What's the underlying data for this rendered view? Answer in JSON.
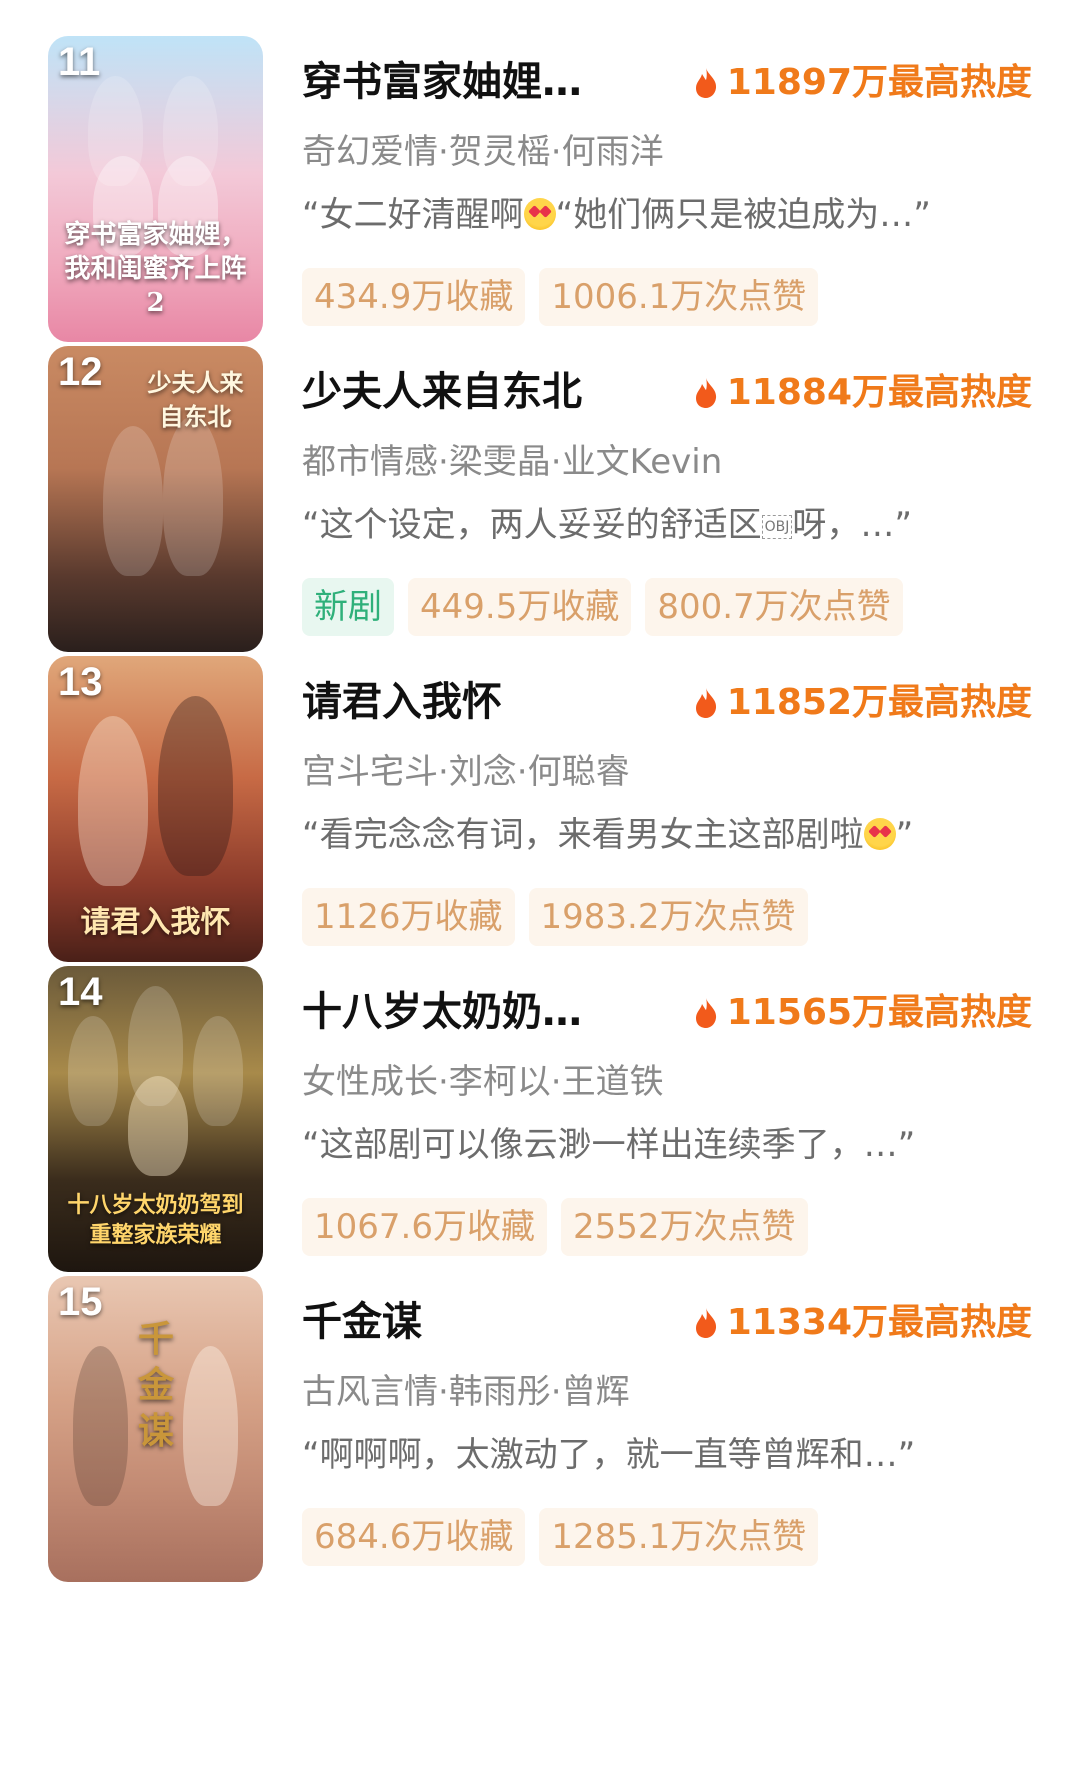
{
  "items": [
    {
      "rank": "11",
      "title": "穿书富家妯娌…",
      "heat": "11897万最高热度",
      "meta": "奇幻爱情·贺灵榣·何雨洋",
      "quote_a": "“女二好清醒啊",
      "quote_b": "“她们俩只是被迫成为…”",
      "poster_title": "穿书富家妯娌，我和闺蜜齐上阵2",
      "tags": [
        "434.9万收藏",
        "1006.1万次点赞"
      ]
    },
    {
      "rank": "12",
      "title": "少夫人来自东北",
      "heat": "11884万最高热度",
      "meta": "都市情感·梁雯晶·业文Kevin",
      "quote_a": "“这个设定，两人妥妥的舒适区",
      "quote_obj": "OBJ",
      "quote_b": "呀，…”",
      "poster_title": "少夫人来自东北",
      "new_tag": "新剧",
      "tags": [
        "449.5万收藏",
        "800.7万次点赞"
      ]
    },
    {
      "rank": "13",
      "title": "请君入我怀",
      "heat": "11852万最高热度",
      "meta": "宫斗宅斗·刘念·何聪睿",
      "quote_a": "“看完念念有词，来看男女主这部剧啦",
      "quote_b": "”",
      "poster_title": "请君入我怀",
      "tags": [
        "1126万收藏",
        "1983.2万次点赞"
      ]
    },
    {
      "rank": "14",
      "title": "十八岁太奶奶…",
      "heat": "11565万最高热度",
      "meta": "女性成长·李柯以·王道铁",
      "quote_a": "“这部剧可以像云渺一样出连续季了，…”",
      "poster_title": "十八岁太奶奶驾到 重整家族荣耀",
      "tags": [
        "1067.6万收藏",
        "2552万次点赞"
      ]
    },
    {
      "rank": "15",
      "title": "千金谋",
      "heat": "11334万最高热度",
      "meta": "古风言情·韩雨彤·曾辉",
      "quote_a": "“啊啊啊，太激动了，就一直等曾辉和…”",
      "poster_title": "千金谋",
      "tags": [
        "684.6万收藏",
        "1285.1万次点赞"
      ]
    }
  ],
  "colors": {
    "heat": "#f07a1a",
    "tag_bg": "#fdf5ec",
    "tag_text": "#d9a06a",
    "new_bg": "#e8f7f0",
    "new_text": "#2fb07a"
  }
}
